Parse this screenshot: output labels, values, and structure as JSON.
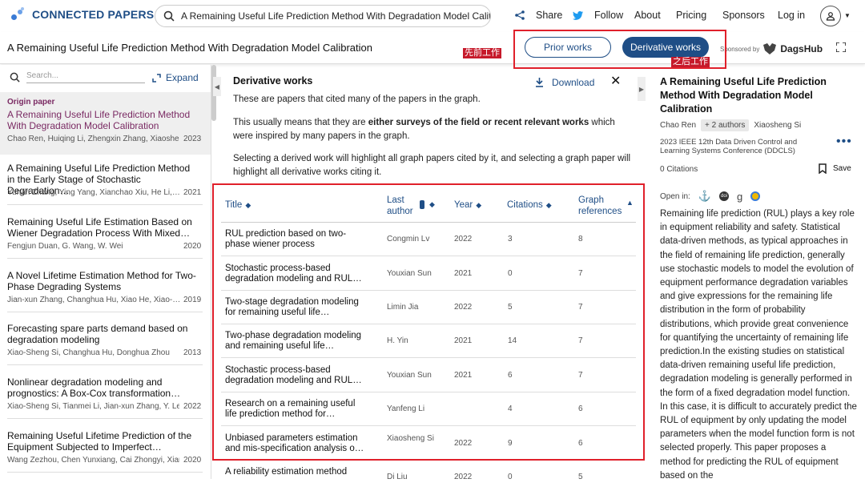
{
  "app": {
    "name": "CONNECTED PAPERS"
  },
  "search": {
    "value": "A Remaining Useful Life Prediction Method With Degradation Model Calit"
  },
  "nav": {
    "share": "Share",
    "follow": "Follow",
    "about": "About",
    "pricing": "Pricing",
    "sponsors": "Sponsors",
    "login": "Log in"
  },
  "header": {
    "paper_title": "A Remaining Useful Life Prediction Method With Degradation Model Calibration",
    "prior": "Prior works",
    "derivative": "Derivative works",
    "sponsored_by": "Sponsored by",
    "sponsor_name": "DagsHub"
  },
  "annotations": {
    "prior_tag": "先前工作",
    "derivative_tag": "之后工作"
  },
  "left": {
    "search_placeholder": "Search...",
    "expand": "Expand",
    "origin_label": "Origin paper",
    "origin": {
      "title": "A Remaining Useful Life Prediction Method With Degradation Model Calibration",
      "authors": "Chao Ren, Huiqing Li, Zhengxin Zhang, Xiaoshe…",
      "year": "2023"
    },
    "items": [
      {
        "title": "A Remaining Useful Life Prediction Method in the Early Stage of Stochastic Degradation…",
        "authors": "Yuhan Zhang, Ying Yang, Xianchao Xiu, He Li,…",
        "year": "2021"
      },
      {
        "title": "Remaining Useful Life Estimation Based on Wiener Degradation Process With Mixed…",
        "authors": "Fengjun Duan, G. Wang, W. Wei",
        "year": "2020"
      },
      {
        "title": "A Novel Lifetime Estimation Method for Two-Phase Degrading Systems",
        "authors": "Jian-xun Zhang, Changhua Hu, Xiao He, Xiao-…",
        "year": "2019"
      },
      {
        "title": "Forecasting spare parts demand based on degradation modeling",
        "authors": "Xiao-Sheng Si, Changhua Hu, Donghua Zhou",
        "year": "2013"
      },
      {
        "title": "Nonlinear degradation modeling and prognostics: A Box-Cox transformation…",
        "authors": "Xiao-Sheng Si, Tianmei Li, Jian-xun Zhang, Y. Lei",
        "year": "2022"
      },
      {
        "title": "Remaining Useful Lifetime Prediction of the Equipment Subjected to Imperfect…",
        "authors": "Wang Zezhou, Chen Yunxiang, Cai Zhongyi, Xian…",
        "year": "2020"
      }
    ]
  },
  "middle": {
    "title": "Derivative works",
    "download": "Download",
    "p1": "These are papers that cited many of the papers in the graph.",
    "p2_a": "This usually means that they are ",
    "p2_b": "either surveys of the field or recent relevant works",
    "p2_c": " which were inspired by many papers in the graph.",
    "p3": "Selecting a derived work will highlight all graph papers cited by it, and selecting a graph paper will highlight all derivative works citing it.",
    "columns": {
      "title": "Title",
      "last_author_1": "Last",
      "last_author_2": "author",
      "year": "Year",
      "citations": "Citations",
      "graph_refs_1": "Graph",
      "graph_refs_2": "references"
    },
    "rows": [
      {
        "title": "RUL prediction based on two-phase wiener process",
        "author": "Congmin Lv",
        "year": "2022",
        "citations": "3",
        "refs": "8"
      },
      {
        "title": "Stochastic process-based degradation modeling and RUL…",
        "author": "Youxian Sun",
        "year": "2021",
        "citations": "0",
        "refs": "7"
      },
      {
        "title": "Two-stage degradation modeling for remaining useful life…",
        "author": "Limin Jia",
        "year": "2022",
        "citations": "5",
        "refs": "7"
      },
      {
        "title": "Two-phase degradation modeling and remaining useful life…",
        "author": "H. Yin",
        "year": "2021",
        "citations": "14",
        "refs": "7"
      },
      {
        "title": "Stochastic process-based degradation modeling and RUL…",
        "author": "Youxian Sun",
        "year": "2021",
        "citations": "6",
        "refs": "7"
      },
      {
        "title": "Research on a remaining useful life prediction method for…",
        "author": "Yanfeng Li",
        "year": "",
        "citations": "4",
        "refs": "6"
      },
      {
        "title": "Unbiased parameters estimation and mis-specification analysis o…",
        "author": "Xiaosheng Si",
        "year": "2022",
        "citations": "9",
        "refs": "6"
      },
      {
        "title": "A reliability estimation method",
        "author": "Di Liu",
        "year": "2022",
        "citations": "0",
        "refs": "5"
      }
    ]
  },
  "right": {
    "title": "A Remaining Useful Life Prediction Method With Degradation Model Calibration",
    "author1": "Chao Ren",
    "more_authors": "+ 2 authors",
    "author_last": "Xiaosheng Si",
    "venue": "2023 IEEE 12th Data Driven Control and Learning Systems Conference (DDCLS)",
    "citations": "0 Citations",
    "save": "Save",
    "open_in": "Open in:",
    "abstract": "Remaining life prediction (RUL) plays a key role in equipment reliability and safety. Statistical data-driven methods, as typical approaches in the field of remaining life prediction, generally use stochastic models to model the evolution of equipment performance degradation variables and give expressions for the remaining life distribution in the form of probability distributions, which provide great convenience for quantifying the uncertainty of remaining life prediction.In the existing studies on statistical data-driven remaining useful life prediction, degradation modeling is generally performed in the form of a fixed degradation model function. In this case, it is difficult to accurately predict the RUL of equipment by only updating the model parameters when the model function form is not selected properly. This paper proposes a method for predicting the RUL of equipment based on the"
  },
  "colors": {
    "brand": "#1f4e86",
    "origin": "#7a2a63",
    "highlight": "#e0202b"
  }
}
